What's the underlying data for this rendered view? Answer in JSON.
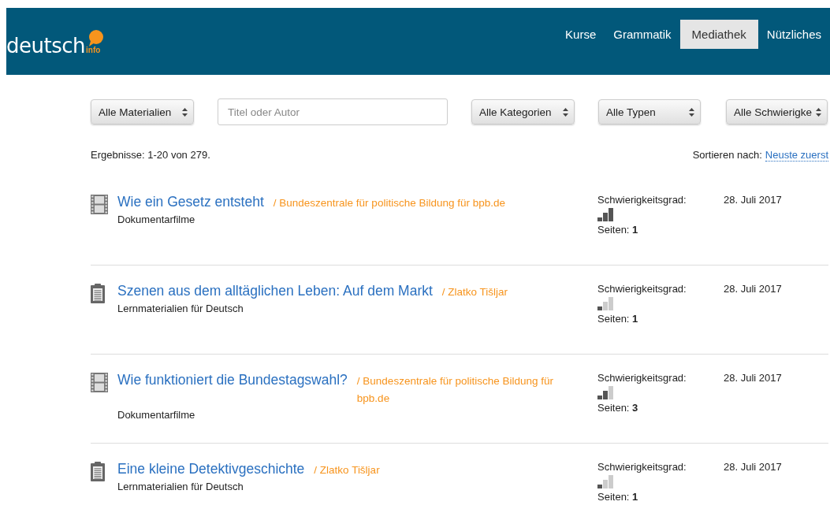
{
  "logo": {
    "word": "deutsch",
    "suffix": "info"
  },
  "nav": [
    {
      "label": "Kurse",
      "selected": false
    },
    {
      "label": "Grammatik",
      "selected": false
    },
    {
      "label": "Mediathek",
      "selected": true
    },
    {
      "label": "Nützliches",
      "selected": false
    }
  ],
  "filters": [
    {
      "kind": "select",
      "value": "Alle Materialien"
    },
    {
      "kind": "input",
      "placeholder": "Titel oder Autor"
    },
    {
      "kind": "select",
      "value": "Alle Kategorien"
    },
    {
      "kind": "select",
      "value": "Alle Typen"
    },
    {
      "kind": "select",
      "value": "Alle Schwierigke"
    }
  ],
  "results_summary": "Ergebnisse: 1-20 von 279.",
  "sort": {
    "label": "Sortieren nach:",
    "value": "Neuste zuerst"
  },
  "results": [
    {
      "kind": "film",
      "title": "Wie ein Gesetz entsteht",
      "author": "/ Bundeszentrale für politische Bildung für bpb.de",
      "category": "Dokumentarfilme",
      "difficulty_label": "Schwierigkeitsgrad:",
      "level": 1,
      "pages_label": "Seiten:",
      "pages": "1",
      "date": "28. Juli 2017"
    },
    {
      "kind": "document",
      "title": "Szenen aus dem alltäglichen Leben: Auf dem Markt",
      "author": "/ Zlatko Tišljar",
      "category": "Lernmaterialien für Deutsch",
      "difficulty_label": "Schwierigkeitsgrad:",
      "level": 0.33,
      "pages_label": "Seiten:",
      "pages": "1",
      "date": "28. Juli 2017"
    },
    {
      "kind": "film",
      "title": "Wie funktioniert die Bundestagswahl?",
      "author": "/ Bundeszentrale für politische Bildung für bpb.de",
      "category": "Dokumentarfilme",
      "difficulty_label": "Schwierigkeitsgrad:",
      "level": 0.67,
      "pages_label": "Seiten:",
      "pages": "3",
      "date": "28. Juli 2017"
    },
    {
      "kind": "document",
      "title": "Eine kleine Detektivgeschichte",
      "author": "/ Zlatko Tišljar",
      "category": "Lernmaterialien für Deutsch",
      "difficulty_label": "Schwierigkeitsgrad:",
      "level": 0.33,
      "pages_label": "Seiten:",
      "pages": "1",
      "date": "28. Juli 2017"
    }
  ]
}
